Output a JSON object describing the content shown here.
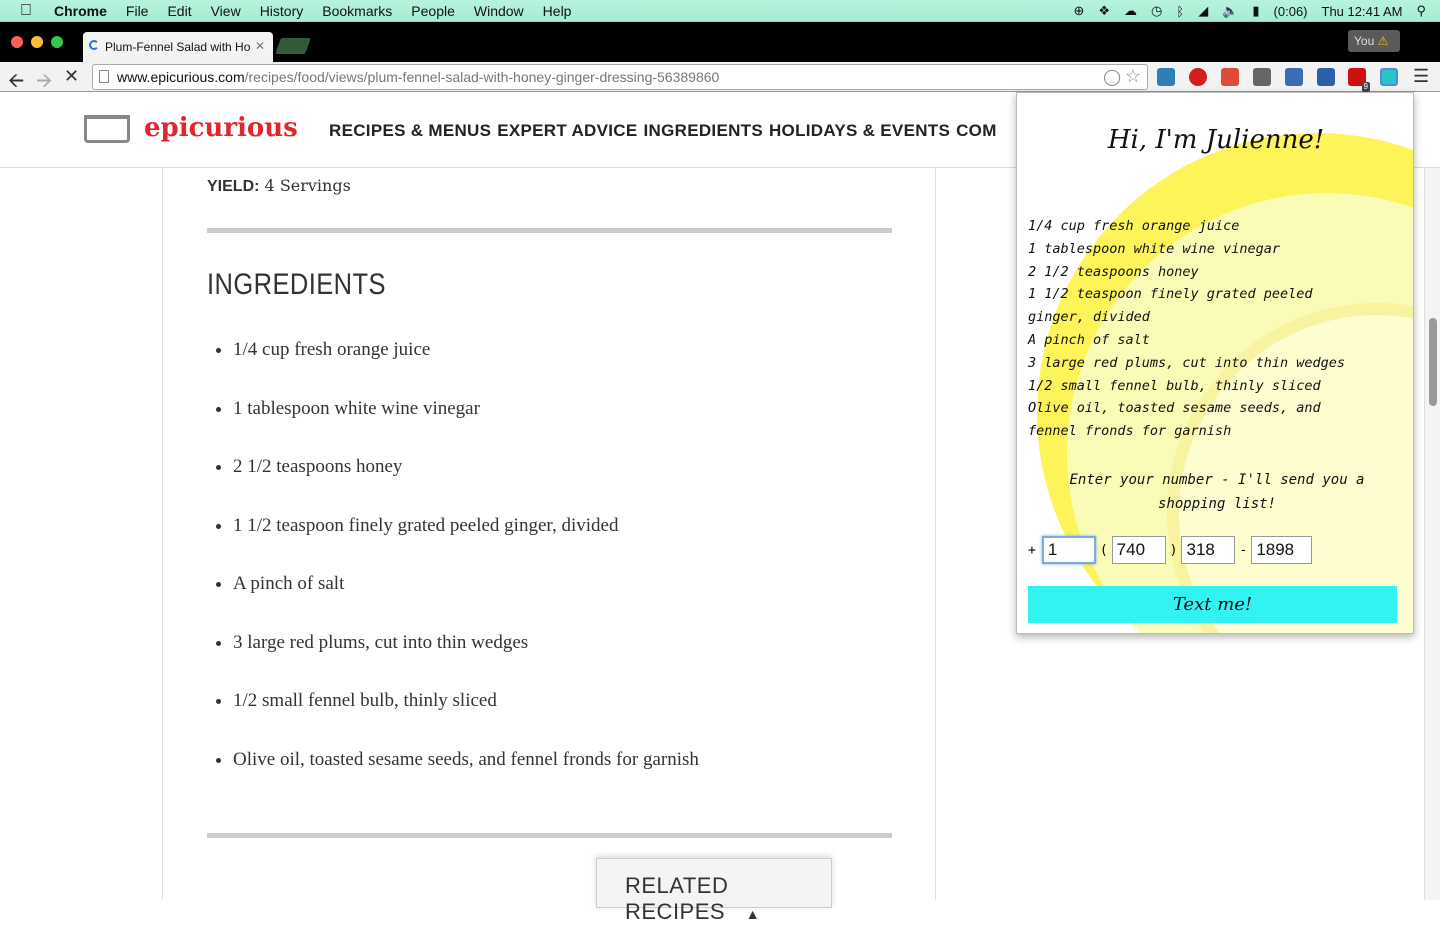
{
  "menubar": {
    "app": "Chrome",
    "items": [
      "File",
      "Edit",
      "View",
      "History",
      "Bookmarks",
      "People",
      "Window",
      "Help"
    ],
    "battery": "(0:06)",
    "clock": "Thu 12:41 AM"
  },
  "tabs": [
    {
      "title": "Plum-Fennel Salad with Ho"
    }
  ],
  "profile": {
    "label": "You"
  },
  "omnibox": {
    "host": "www.epicurious.com",
    "path": "/recipes/food/views/plum-fennel-salad-with-honey-ginger-dressing-56389860"
  },
  "extensions": {
    "abp_badge": "9"
  },
  "site": {
    "logo": "epicurious",
    "nav": [
      "RECIPES & MENUS",
      "EXPERT ADVICE",
      "INGREDIENTS",
      "HOLIDAYS & EVENTS",
      "COM"
    ]
  },
  "recipe": {
    "yield_label": "YIELD:",
    "yield_value": "4 Servings",
    "ingredients_heading": "INGREDIENTS",
    "ingredients": [
      "1/4 cup fresh orange juice",
      "1 tablespoon white wine vinegar",
      "2 1/2 teaspoons honey",
      "1 1/2 teaspoon finely grated peeled ginger, divided",
      "A pinch of salt",
      "3 large red plums, cut into thin wedges",
      "1/2 small fennel bulb, thinly sliced",
      "Olive oil, toasted sesame seeds, and fennel fronds for garnish"
    ],
    "related_label": "RELATED RECIPES"
  },
  "popup": {
    "title": "Hi, I'm Julienne!",
    "items": [
      "1/4 cup fresh orange juice",
      "1 tablespoon white wine vinegar",
      "2 1/2 teaspoons honey",
      "1 1/2 teaspoon finely grated peeled ginger, divided",
      "A pinch of salt",
      "3 large red plums, cut into thin wedges",
      "1/2 small fennel bulb, thinly sliced",
      "Olive oil, toasted sesame seeds, and fennel fronds for garnish"
    ],
    "prompt": "Enter your number - I'll send you a shopping list!",
    "phone": {
      "plus": "+",
      "country": "1",
      "open_paren": "(",
      "area": "740",
      "close_paren": ")",
      "prefix": "318",
      "dash": "-",
      "line": "1898"
    },
    "button": "Text me!"
  },
  "colors": {
    "menubar": "#b7f3dc",
    "brand_red": "#e3262d",
    "popup_button": "#33f2f2",
    "lemon_yellow": "#fdf45a"
  }
}
